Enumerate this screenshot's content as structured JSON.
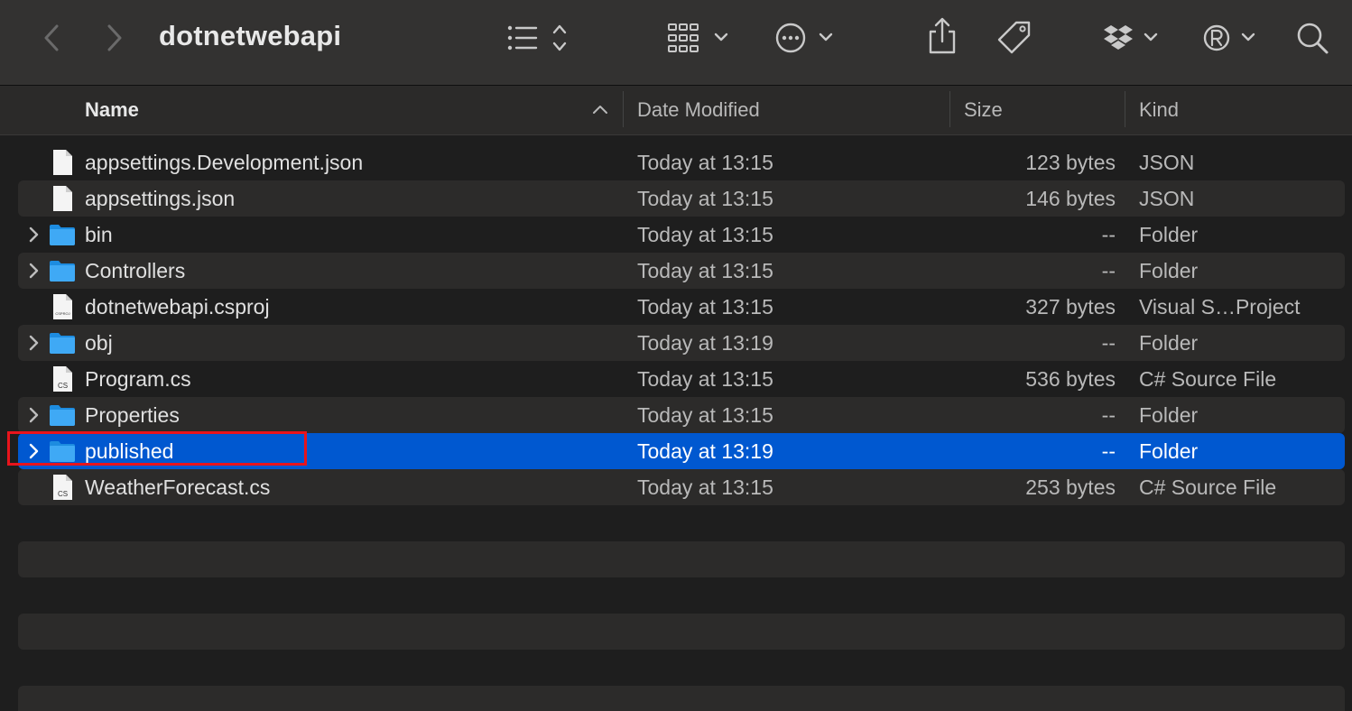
{
  "window": {
    "title": "dotnetwebapi"
  },
  "toolbar": {
    "back_icon": "chevron-left-icon",
    "forward_icon": "chevron-right-icon",
    "view_icon": "list-view-icon",
    "group_icon": "grid-group-icon",
    "more_icon": "ellipsis-circle-icon",
    "share_icon": "share-icon",
    "tag_icon": "tag-icon",
    "dropbox_icon": "dropbox-icon",
    "registered_icon": "registered-icon",
    "search_icon": "search-icon"
  },
  "columns": {
    "name": "Name",
    "date": "Date Modified",
    "size": "Size",
    "kind": "Kind"
  },
  "files": [
    {
      "name": "appsettings.Development.json",
      "date": "Today at 13:15",
      "size": "123 bytes",
      "kind": "JSON",
      "type": "doc",
      "folder": false,
      "selected": false
    },
    {
      "name": "appsettings.json",
      "date": "Today at 13:15",
      "size": "146 bytes",
      "kind": "JSON",
      "type": "doc",
      "folder": false,
      "selected": false
    },
    {
      "name": "bin",
      "date": "Today at 13:15",
      "size": "--",
      "kind": "Folder",
      "type": "folder",
      "folder": true,
      "selected": false
    },
    {
      "name": "Controllers",
      "date": "Today at 13:15",
      "size": "--",
      "kind": "Folder",
      "type": "folder",
      "folder": true,
      "selected": false
    },
    {
      "name": "dotnetwebapi.csproj",
      "date": "Today at 13:15",
      "size": "327 bytes",
      "kind": "Visual S…Project",
      "type": "csproj",
      "folder": false,
      "selected": false
    },
    {
      "name": "obj",
      "date": "Today at 13:19",
      "size": "--",
      "kind": "Folder",
      "type": "folder",
      "folder": true,
      "selected": false
    },
    {
      "name": "Program.cs",
      "date": "Today at 13:15",
      "size": "536 bytes",
      "kind": "C# Source File",
      "type": "cs",
      "folder": false,
      "selected": false
    },
    {
      "name": "Properties",
      "date": "Today at 13:15",
      "size": "--",
      "kind": "Folder",
      "type": "folder",
      "folder": true,
      "selected": false
    },
    {
      "name": "published",
      "date": "Today at 13:19",
      "size": "--",
      "kind": "Folder",
      "type": "folder",
      "folder": true,
      "selected": true
    },
    {
      "name": "WeatherForecast.cs",
      "date": "Today at 13:15",
      "size": "253 bytes",
      "kind": "C# Source File",
      "type": "cs",
      "folder": false,
      "selected": false
    }
  ],
  "icon_labels": {
    "cs": "CS",
    "csproj": "CSPROJ"
  },
  "colors": {
    "selection": "#0058d0",
    "folder": "#3fa9f5",
    "highlight": "#e8141c"
  }
}
